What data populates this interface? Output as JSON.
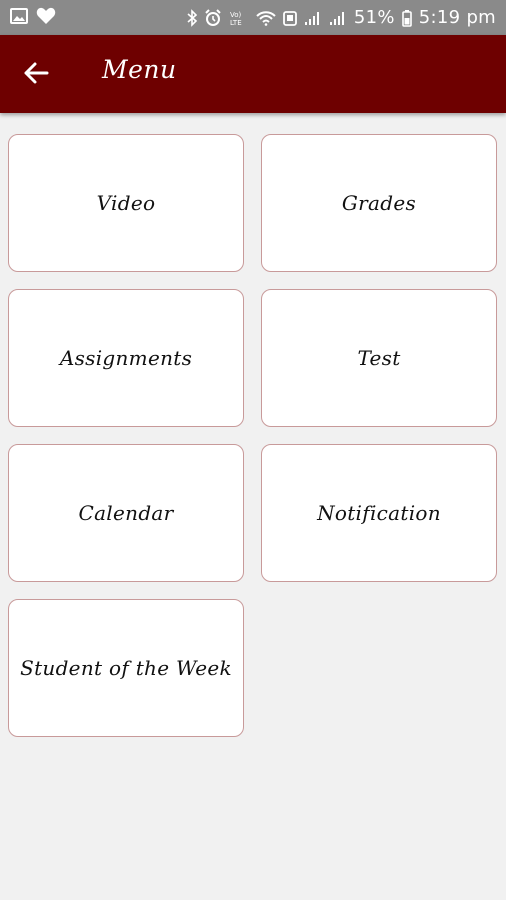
{
  "status_bar": {
    "battery": "51%",
    "time": "5:19 pm",
    "icons": [
      "image-icon",
      "heart-icon",
      "bluetooth-icon",
      "alarm-icon",
      "volte-icon",
      "wifi-icon",
      "data-icon",
      "signal-icon",
      "signal-icon",
      "battery-icon"
    ]
  },
  "app_bar": {
    "title": "Menu",
    "back_icon": "arrow-left-icon",
    "color": "#6e0000"
  },
  "menu": {
    "items": [
      {
        "label": "Video"
      },
      {
        "label": "Grades"
      },
      {
        "label": "Assignments"
      },
      {
        "label": "Test"
      },
      {
        "label": "Calendar"
      },
      {
        "label": "Notification"
      },
      {
        "label": "Student of the Week"
      }
    ]
  }
}
